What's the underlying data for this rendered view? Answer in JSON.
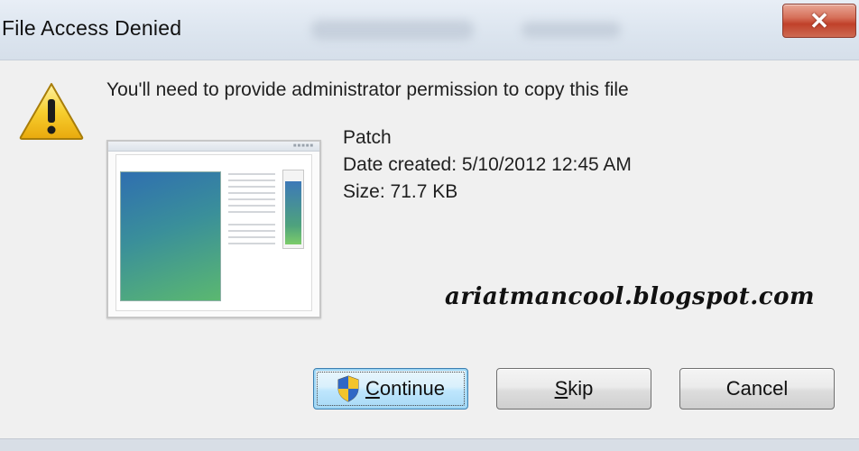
{
  "window": {
    "title": "File Access Denied",
    "close_label": "X"
  },
  "dialog": {
    "message": "You'll need to provide administrator permission to copy this file",
    "file": {
      "name": "Patch",
      "date_created": "Date created: 5/10/2012 12:45 AM",
      "size": "Size: 71.7 KB"
    },
    "watermark": "ariatmancool.blogspot.com"
  },
  "buttons": {
    "continue_first": "C",
    "continue_rest": "ontinue",
    "skip_first": "S",
    "skip_rest": "kip",
    "cancel": "Cancel"
  },
  "icons": {
    "warning": "warning-icon",
    "shield": "uac-shield-icon",
    "file_thumbnail": "file-thumbnail-icon"
  },
  "colors": {
    "accent_button": "#bee6fd",
    "close_button": "#c0412a"
  }
}
